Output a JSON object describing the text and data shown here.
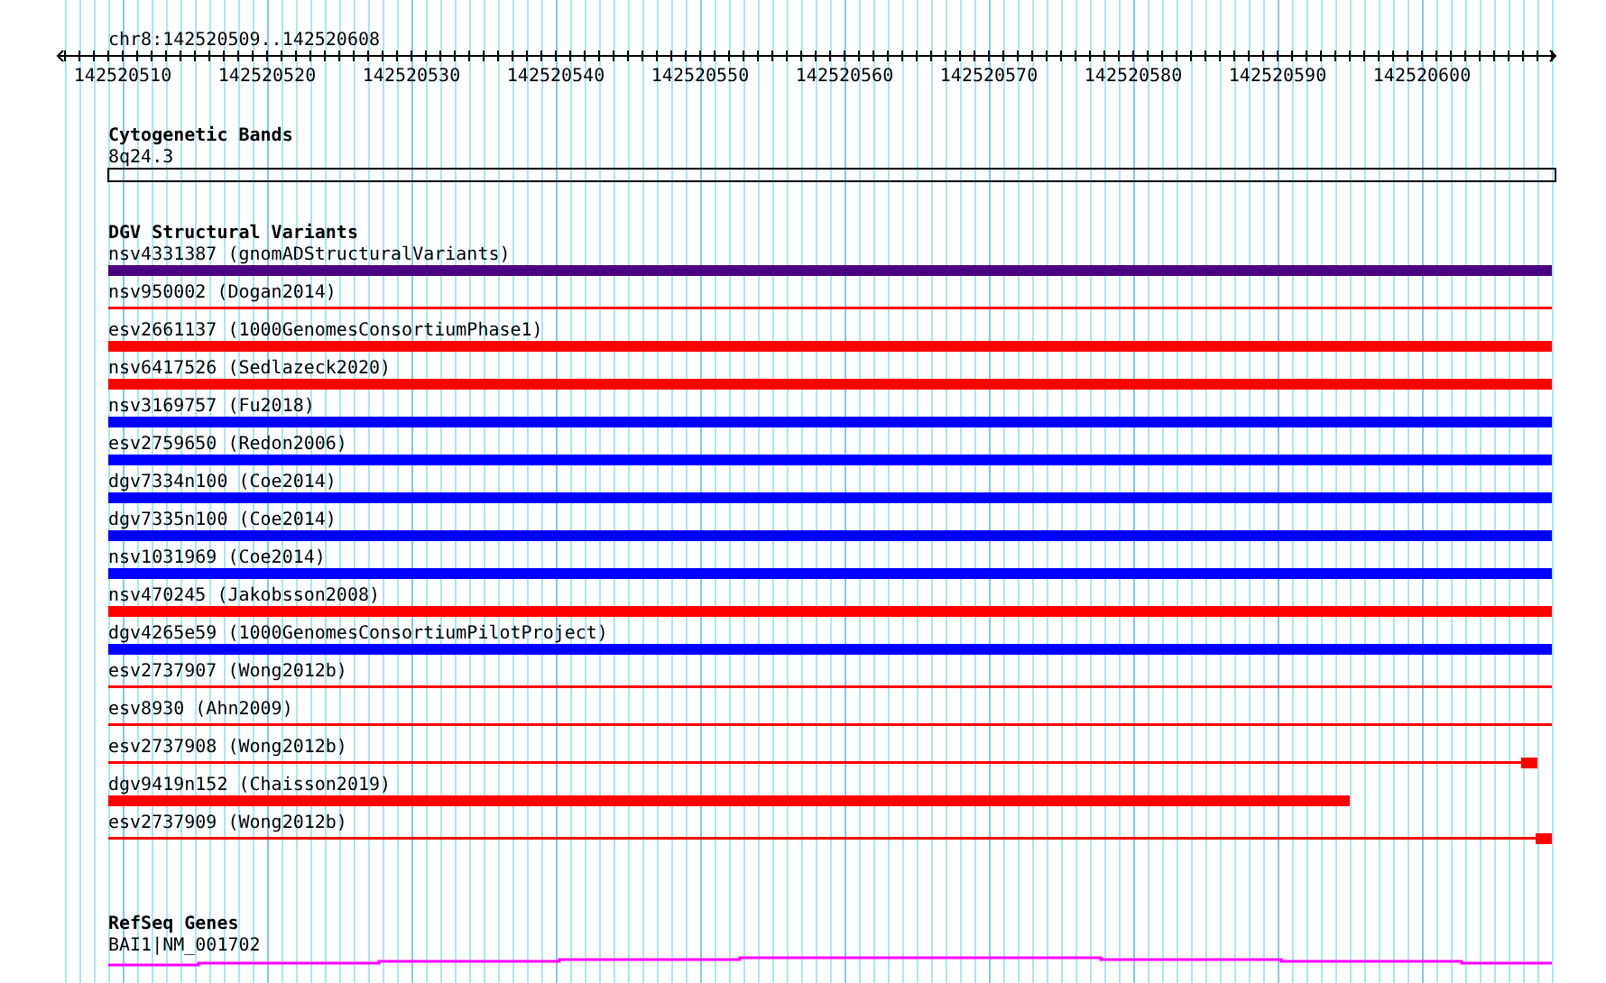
{
  "ruler": {
    "label": "chr8:142520509..142520608",
    "ticks": [
      "142520510",
      "142520520",
      "142520530",
      "142520540",
      "142520550",
      "142520560",
      "142520570",
      "142520580",
      "142520590",
      "142520600"
    ]
  },
  "cytogenetic_bands": {
    "title": "Cytogenetic Bands",
    "band": {
      "label": "8q24.3"
    }
  },
  "dgv": {
    "title": "DGV Structural Variants",
    "variants": [
      {
        "label": "nsv4331387 (gnomADStructuralVariants)",
        "color": "#4b0082",
        "kind": "thick",
        "level": 1
      },
      {
        "label": "nsv950002 (Dogan2014)",
        "color": "#ff0000",
        "kind": "thin",
        "level": 1
      },
      {
        "label": "esv2661137 (1000GenomesConsortiumPhase1)",
        "color": "#ff0000",
        "kind": "thick",
        "level": 1
      },
      {
        "label": "nsv6417526 (Sedlazeck2020)",
        "color": "#ff0000",
        "kind": "thick",
        "level": 1
      },
      {
        "label": "nsv3169757 (Fu2018)",
        "color": "#0000ff",
        "kind": "thick",
        "level": 1
      },
      {
        "label": "esv2759650 (Redon2006)",
        "color": "#0000ff",
        "kind": "thick",
        "level": 1
      },
      {
        "label": "dgv7334n100 (Coe2014)",
        "color": "#0000ff",
        "kind": "thick",
        "level": 1
      },
      {
        "label": "dgv7335n100 (Coe2014)",
        "color": "#0000ff",
        "kind": "thick",
        "level": 1
      },
      {
        "label": "nsv1031969 (Coe2014)",
        "color": "#0000ff",
        "kind": "thick",
        "level": 1
      },
      {
        "label": "nsv470245 (Jakobsson2008)",
        "color": "#ff0000",
        "kind": "thick",
        "level": 1
      },
      {
        "label": "dgv4265e59 (1000GenomesConsortiumPilotProject)",
        "color": "#0000ff",
        "kind": "thick",
        "level": 1
      },
      {
        "label": "esv2737907 (Wong2012b)",
        "color": "#ff0000",
        "kind": "thin",
        "level": 1
      },
      {
        "label": "esv8930 (Ahn2009)",
        "color": "#ff0000",
        "kind": "thin",
        "level": 1
      },
      {
        "label": "esv2737908 (Wong2012b)",
        "color": "#ff0000",
        "kind": "thin-block",
        "level": 0.99
      },
      {
        "label": "dgv9419n152 (Chaisson2019)",
        "color": "#ff0000",
        "kind": "thick",
        "level": 0.86
      },
      {
        "label": "esv2737909 (Wong2012b)",
        "color": "#ff0000",
        "kind": "thin-block",
        "level": 1
      }
    ]
  },
  "refseq_genes": {
    "title": "RefSeq Genes",
    "gene": {
      "label": "BAI1|NM_001702"
    }
  }
}
